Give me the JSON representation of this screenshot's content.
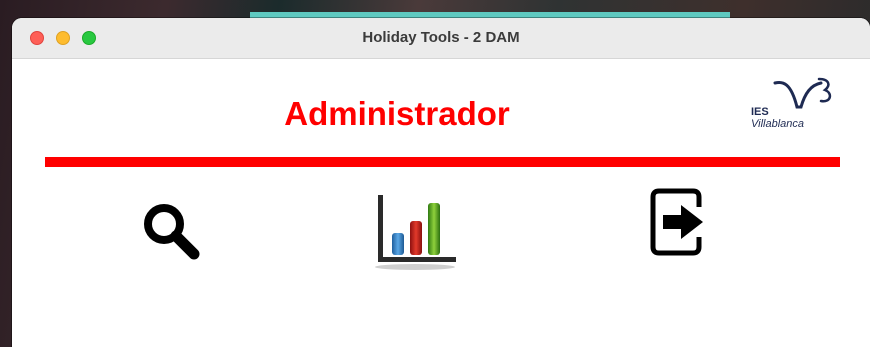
{
  "window": {
    "title": "Holiday Tools - 2 DAM"
  },
  "header": {
    "title": "Administrador",
    "title_color": "#ff0000",
    "logo": {
      "line1": "IES",
      "line2": "Villablanca"
    }
  },
  "toolbar": {
    "items": [
      {
        "icon": "search-icon"
      },
      {
        "icon": "bar-chart-icon"
      },
      {
        "icon": "exit-icon"
      }
    ]
  },
  "colors": {
    "accent": "#ff0000",
    "window_bg": "#ffffff",
    "titlebar_bg": "#ebebeb",
    "logo_color": "#1e2a52"
  }
}
